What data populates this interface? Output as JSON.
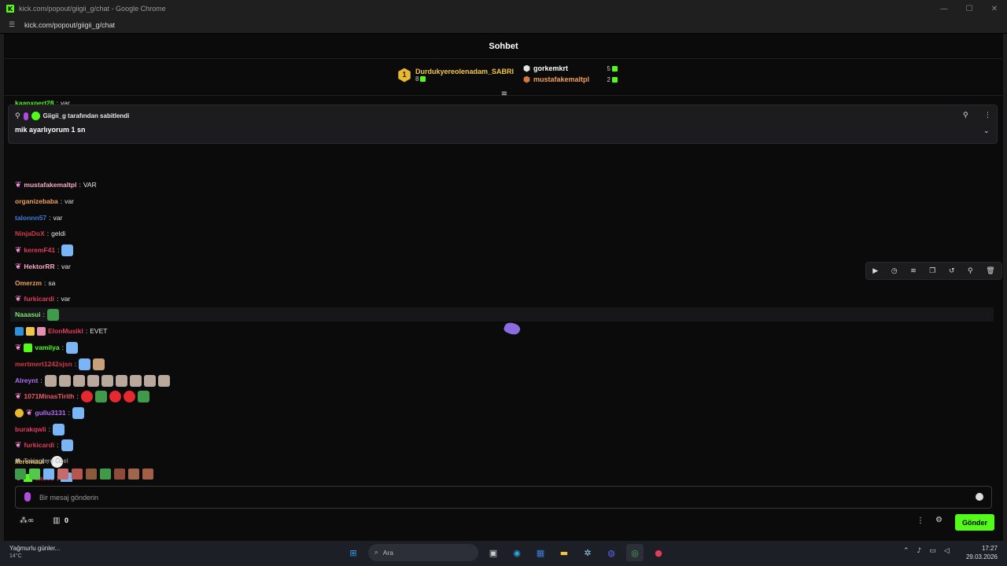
{
  "window": {
    "title": "kick.com/popout/giigii_g/chat - Google Chrome",
    "url": "kick.com/popout/giigii_g/chat",
    "brand_color": "#53fc18"
  },
  "header": {
    "title": "Sohbet"
  },
  "leaderboard": {
    "first": {
      "rank": "1",
      "name": "Durdukyereolenadam_SABRI",
      "count": "8"
    },
    "second": {
      "name": "gorkemkrt",
      "count": "5"
    },
    "third": {
      "name": "mustafakemaltpl",
      "count": "2"
    }
  },
  "pinned": {
    "author_line": "Giigii_g tarafından sabitlendi",
    "message": "mik ayarlıyorum 1 sn"
  },
  "partial_line": {
    "user": "kaanxpert28",
    "message": "var"
  },
  "messages": [
    {
      "user": "mustafakemaltpl",
      "message": "VAR"
    },
    {
      "user": "organizebaba",
      "message": "var"
    },
    {
      "user": "talonnn57",
      "message": "var"
    },
    {
      "user": "NinjaDoX",
      "message": "geldi"
    },
    {
      "user": "keremF41",
      "message": ""
    },
    {
      "user": "HektorRR",
      "message": "var"
    },
    {
      "user": "Omerzm",
      "message": "sa"
    },
    {
      "user": "furkicardi",
      "message": "var"
    },
    {
      "user": "Naaasui",
      "message": ""
    },
    {
      "user": "ElonMusikl",
      "message": "EVET"
    },
    {
      "user": "vamilya",
      "message": ""
    },
    {
      "user": "mertmert1242sjsn",
      "message": ""
    },
    {
      "user": "Alreynt",
      "message": ""
    },
    {
      "user": "1071MinasTirith",
      "message": ""
    },
    {
      "user": "gullu3131",
      "message": ""
    },
    {
      "user": "burakqwli",
      "message": ""
    },
    {
      "user": "furkicardi",
      "message": ""
    },
    {
      "user": "keremaul",
      "message": ""
    },
    {
      "user": "akoo3",
      "message": ""
    }
  ],
  "followers_label": "Takipçilere Özel",
  "input": {
    "placeholder": "Bir mesaj gönderin"
  },
  "bottom": {
    "points": "0",
    "send_label": "Gönder"
  },
  "taskbar": {
    "weather_title": "Yağmurlu günler...",
    "weather_temp": "14°C",
    "search_label": "Ara",
    "time": "17:27",
    "date": "29.03.2026"
  }
}
